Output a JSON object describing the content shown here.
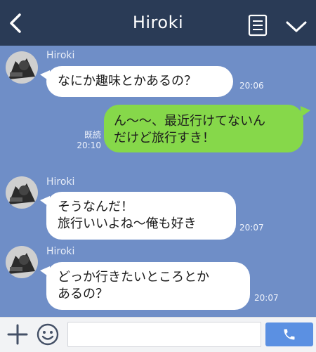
{
  "header": {
    "title": "Hiroki",
    "back_icon": "chevron-left-icon",
    "notes_icon": "notes-icon",
    "menu_icon": "chevron-down-icon",
    "bg_color": "#2a3b56"
  },
  "chat": {
    "bg_color": "#6f8ec7",
    "messages": [
      {
        "side": "left",
        "sender": "Hiroki",
        "lines": [
          "なにか趣味とかあるの？"
        ],
        "time": "20:06"
      },
      {
        "side": "right",
        "lines": [
          "ん〜〜、最近行けてないん",
          "だけど旅行すき！"
        ],
        "read": "既読",
        "time": "20:10"
      },
      {
        "side": "left",
        "sender": "Hiroki",
        "lines": [
          "そうなんだ！",
          "旅行いいよね〜俺も好き"
        ],
        "time": "20:07"
      },
      {
        "side": "left",
        "sender": "Hiroki",
        "lines": [
          "どっか行きたいところとか",
          "あるの？"
        ],
        "time": "20:07"
      }
    ]
  },
  "input_bar": {
    "plus_icon": "plus-icon",
    "emoji_icon": "smiley-icon",
    "text_value": "",
    "call_icon": "phone-icon",
    "call_color": "#5b90e2"
  }
}
